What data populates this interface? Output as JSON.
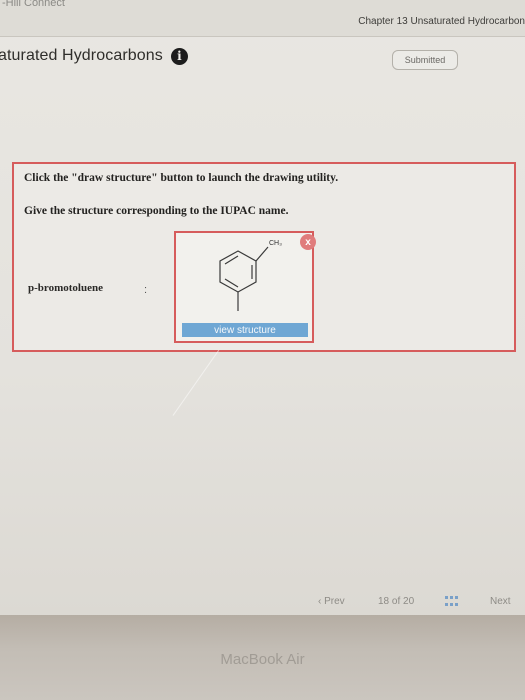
{
  "header": {
    "brand": "-Hill Connect",
    "chapter_title": "Chapter 13 Unsaturated Hydrocarbon"
  },
  "page": {
    "title": "aturated Hydrocarbons",
    "info_icon": "i",
    "status": "Submitted"
  },
  "question": {
    "instruction_1": "Click the \"draw structure\" button to launch the drawing utility.",
    "instruction_2": "Give the structure corresponding to the IUPAC name.",
    "iupac_name": "p-bromotoluene",
    "separator": ":",
    "structure_label": "CH₃",
    "close_icon": "x",
    "view_button_label": "view structure"
  },
  "pager": {
    "prev_label": "‹ Prev",
    "page_indicator": "18 of 20",
    "next_label": "Next"
  },
  "bezel": {
    "label": "MacBook Air"
  },
  "colors": {
    "accent_red": "#d65c5c",
    "button_blue": "#6fa7d4",
    "badge_border": "#b4b1aa"
  }
}
